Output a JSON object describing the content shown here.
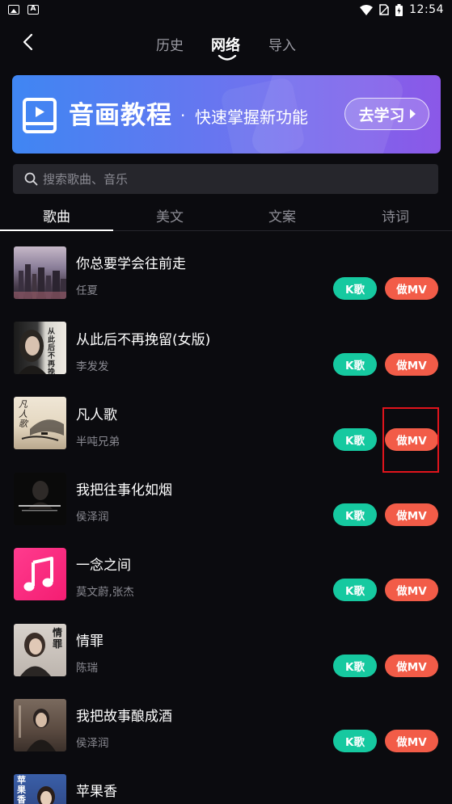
{
  "status_bar": {
    "time": "12:54"
  },
  "top_tabs": [
    "历史",
    "网络",
    "导入"
  ],
  "banner": {
    "title": "音画教程",
    "dot": "·",
    "subtitle": "快速掌握新功能",
    "button": "去学习"
  },
  "search": {
    "placeholder": "搜索歌曲、音乐"
  },
  "category_tabs": [
    "歌曲",
    "美文",
    "文案",
    "诗词"
  ],
  "songs": [
    {
      "title": "你总要学会往前走",
      "artist": "任夏"
    },
    {
      "title": "从此后不再挽留(女版)",
      "artist": "李发发",
      "cover_text": "从此后不再挽留"
    },
    {
      "title": "凡人歌",
      "artist": "半吨兄弟",
      "cover_text": "凡人歌"
    },
    {
      "title": "我把往事化如烟",
      "artist": "侯泽润"
    },
    {
      "title": "一念之间",
      "artist": "莫文蔚,张杰"
    },
    {
      "title": "情罪",
      "artist": "陈瑞",
      "cover_text": "情罪"
    },
    {
      "title": "我把故事酿成酒",
      "artist": "侯泽润"
    },
    {
      "title": "苹果香",
      "artist": "",
      "cover_text": "苹果香"
    }
  ],
  "buttons": {
    "k": "K歌",
    "mv": "做MV"
  },
  "colors": {
    "k_button": "#16c9a0",
    "mv_button": "#f25c48",
    "highlight": "#e0141c",
    "banner_start": "#3f86f3",
    "banner_end": "#8b58e8"
  },
  "icons": {
    "back": "back-arrow-icon",
    "search": "search-icon",
    "banner": "book-icon",
    "music": "music-note-icon"
  }
}
